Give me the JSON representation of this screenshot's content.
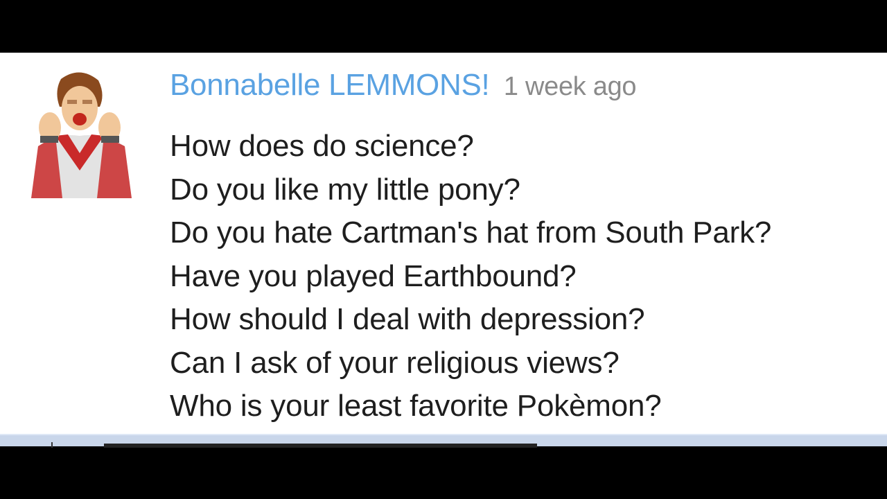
{
  "comment": {
    "author": "Bonnabelle LEMMONS!",
    "timestamp": "1 week ago",
    "lines": [
      "How does do science?",
      "Do you like my little pony?",
      "Do you hate Cartman's hat from South Park?",
      "Have you played Earthbound?",
      "How should I deal with depression?",
      "Can I ask of your religious views?",
      "Who is your least favorite Pokèmon?"
    ]
  },
  "colors": {
    "author": "#5aa2e2",
    "timestamp": "#8a8a8a",
    "text": "#1e1e1e",
    "panel": "#ffffff",
    "frame": "#000000"
  }
}
